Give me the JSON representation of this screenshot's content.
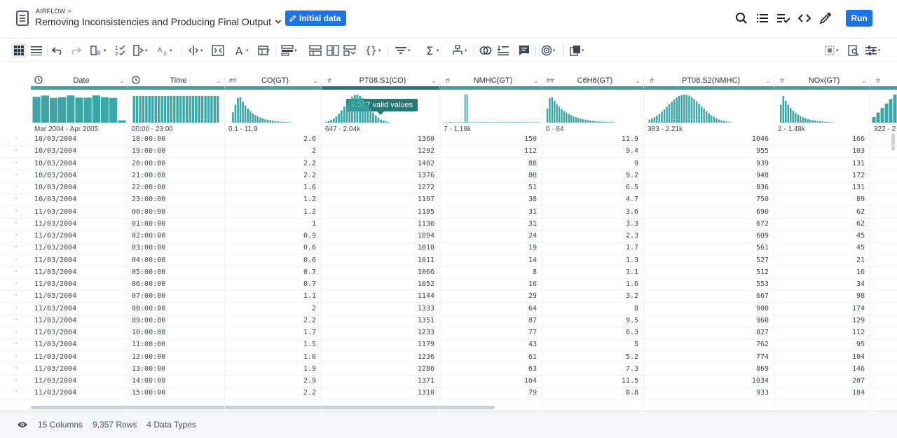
{
  "header": {
    "breadcrumb": "AIRFLOW >",
    "title": "Removing Inconsistencies and Producing Final Output",
    "badge_label": "Initial data",
    "run_label": "Run",
    "icons": [
      "search-icon",
      "list-icon",
      "checklist-icon",
      "code-icon",
      "eyedropper-icon"
    ]
  },
  "colors": {
    "accent": "#1a73e8",
    "histogram": "#3aa6a6",
    "tooltip": "#1f7b75"
  },
  "columns": [
    {
      "type": "clock",
      "name": "Date",
      "range": "Mar 2004 - Apr 2005"
    },
    {
      "type": "clock",
      "name": "Time",
      "range": "00:00 - 23:00"
    },
    {
      "type": "##",
      "name": "CO(GT)",
      "range": "0.1 - 11.9"
    },
    {
      "type": "#",
      "name": "PT08.S1(CO)",
      "range": "647 - 2.04k"
    },
    {
      "type": "#",
      "name": "NMHC(GT)",
      "range": "7 - 1.19k"
    },
    {
      "type": "##",
      "name": "C6H6(GT)",
      "range": "0 - 64"
    },
    {
      "type": "#",
      "name": "PT08.S2(NMHC)",
      "range": "383 - 2.21k"
    },
    {
      "type": "#",
      "name": "NOx(GT)",
      "range": "2 - 1.48k"
    },
    {
      "type": "#",
      "name": "",
      "range": "322 - 2"
    }
  ],
  "tooltip": "9,357 valid values",
  "rows": [
    [
      "10/03/2004",
      "18:00:00",
      "2.6",
      "1360",
      "150",
      "11.9",
      "1046",
      "166"
    ],
    [
      "10/03/2004",
      "19:00:00",
      "2",
      "1292",
      "112",
      "9.4",
      "955",
      "103"
    ],
    [
      "10/03/2004",
      "20:00:00",
      "2.2",
      "1402",
      "88",
      "9",
      "939",
      "131"
    ],
    [
      "10/03/2004",
      "21:00:00",
      "2.2",
      "1376",
      "80",
      "9.2",
      "948",
      "172"
    ],
    [
      "10/03/2004",
      "22:00:00",
      "1.6",
      "1272",
      "51",
      "6.5",
      "836",
      "131"
    ],
    [
      "10/03/2004",
      "23:00:00",
      "1.2",
      "1197",
      "38",
      "4.7",
      "750",
      "89"
    ],
    [
      "11/03/2004",
      "00:00:00",
      "1.2",
      "1185",
      "31",
      "3.6",
      "690",
      "62"
    ],
    [
      "11/03/2004",
      "01:00:00",
      "1",
      "1136",
      "31",
      "3.3",
      "672",
      "62"
    ],
    [
      "11/03/2004",
      "02:00:00",
      "0.9",
      "1094",
      "24",
      "2.3",
      "609",
      "45"
    ],
    [
      "11/03/2004",
      "03:00:00",
      "0.6",
      "1010",
      "19",
      "1.7",
      "561",
      "45"
    ],
    [
      "11/03/2004",
      "04:00:00",
      "0.6",
      "1011",
      "14",
      "1.3",
      "527",
      "21"
    ],
    [
      "11/03/2004",
      "05:00:00",
      "0.7",
      "1066",
      "8",
      "1.1",
      "512",
      "16"
    ],
    [
      "11/03/2004",
      "06:00:00",
      "0.7",
      "1052",
      "16",
      "1.6",
      "553",
      "34"
    ],
    [
      "11/03/2004",
      "07:00:00",
      "1.1",
      "1144",
      "29",
      "3.2",
      "667",
      "98"
    ],
    [
      "11/03/2004",
      "08:00:00",
      "2",
      "1333",
      "64",
      "8",
      "900",
      "174"
    ],
    [
      "11/03/2004",
      "09:00:00",
      "2.2",
      "1351",
      "87",
      "9.5",
      "960",
      "129"
    ],
    [
      "11/03/2004",
      "10:00:00",
      "1.7",
      "1233",
      "77",
      "6.3",
      "827",
      "112"
    ],
    [
      "11/03/2004",
      "11:00:00",
      "1.5",
      "1179",
      "43",
      "5",
      "762",
      "95"
    ],
    [
      "11/03/2004",
      "12:00:00",
      "1.6",
      "1236",
      "61",
      "5.2",
      "774",
      "104"
    ],
    [
      "11/03/2004",
      "13:00:00",
      "1.9",
      "1286",
      "63",
      "7.3",
      "869",
      "146"
    ],
    [
      "11/03/2004",
      "14:00:00",
      "2.9",
      "1371",
      "164",
      "11.5",
      "1034",
      "207"
    ],
    [
      "11/03/2004",
      "15:00:00",
      "2.2",
      "1310",
      "79",
      "8.8",
      "933",
      "184"
    ]
  ],
  "footer": {
    "columns": "15 Columns",
    "rows": "9,357 Rows",
    "types": "4 Data Types"
  }
}
